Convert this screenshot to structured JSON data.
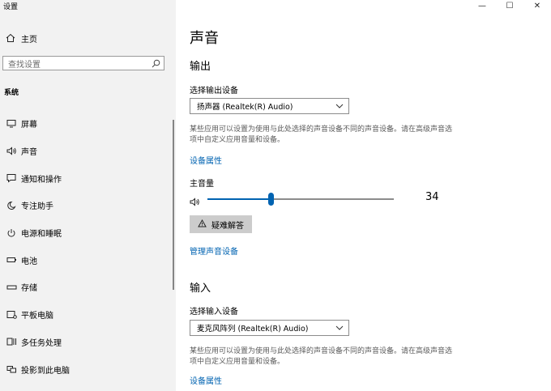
{
  "window": {
    "title": "设置",
    "minimize": "—",
    "maximize": "☐",
    "close": "✕"
  },
  "sidebar": {
    "home_label": "主页",
    "search_placeholder": "查找设置",
    "section_label": "系统",
    "items": [
      {
        "label": "屏幕",
        "icon": "display-icon"
      },
      {
        "label": "声音",
        "icon": "speaker-icon"
      },
      {
        "label": "通知和操作",
        "icon": "notification-icon"
      },
      {
        "label": "专注助手",
        "icon": "moon-icon"
      },
      {
        "label": "电源和睡眠",
        "icon": "power-icon"
      },
      {
        "label": "电池",
        "icon": "battery-icon"
      },
      {
        "label": "存储",
        "icon": "storage-icon"
      },
      {
        "label": "平板电脑",
        "icon": "tablet-icon"
      },
      {
        "label": "多任务处理",
        "icon": "multitask-icon"
      },
      {
        "label": "投影到此电脑",
        "icon": "project-icon"
      }
    ]
  },
  "main": {
    "page_title": "声音",
    "output": {
      "heading": "输出",
      "device_label": "选择输出设备",
      "device_value": "扬声器 (Realtek(R) Audio)",
      "description": "某些应用可以设置为使用与此处选择的声音设备不同的声音设备。请在高级声音选项中自定义应用音量和设备。",
      "device_properties_link": "设备属性",
      "volume_label": "主音量",
      "volume_value": "34",
      "volume_level": 34,
      "troubleshoot_label": "疑难解答",
      "manage_link": "管理声音设备"
    },
    "input": {
      "heading": "输入",
      "device_label": "选择输入设备",
      "device_value": "麦克风阵列 (Realtek(R) Audio)",
      "description": "某些应用可以设置为使用与此处选择的声音设备不同的声音设备。请在高级声音选项中自定义应用音量和设备。",
      "device_properties_link": "设备属性"
    }
  },
  "colors": {
    "accent": "#0063b1",
    "sidebar_bg": "#f2f2f2",
    "button_bg": "#cccccc"
  }
}
